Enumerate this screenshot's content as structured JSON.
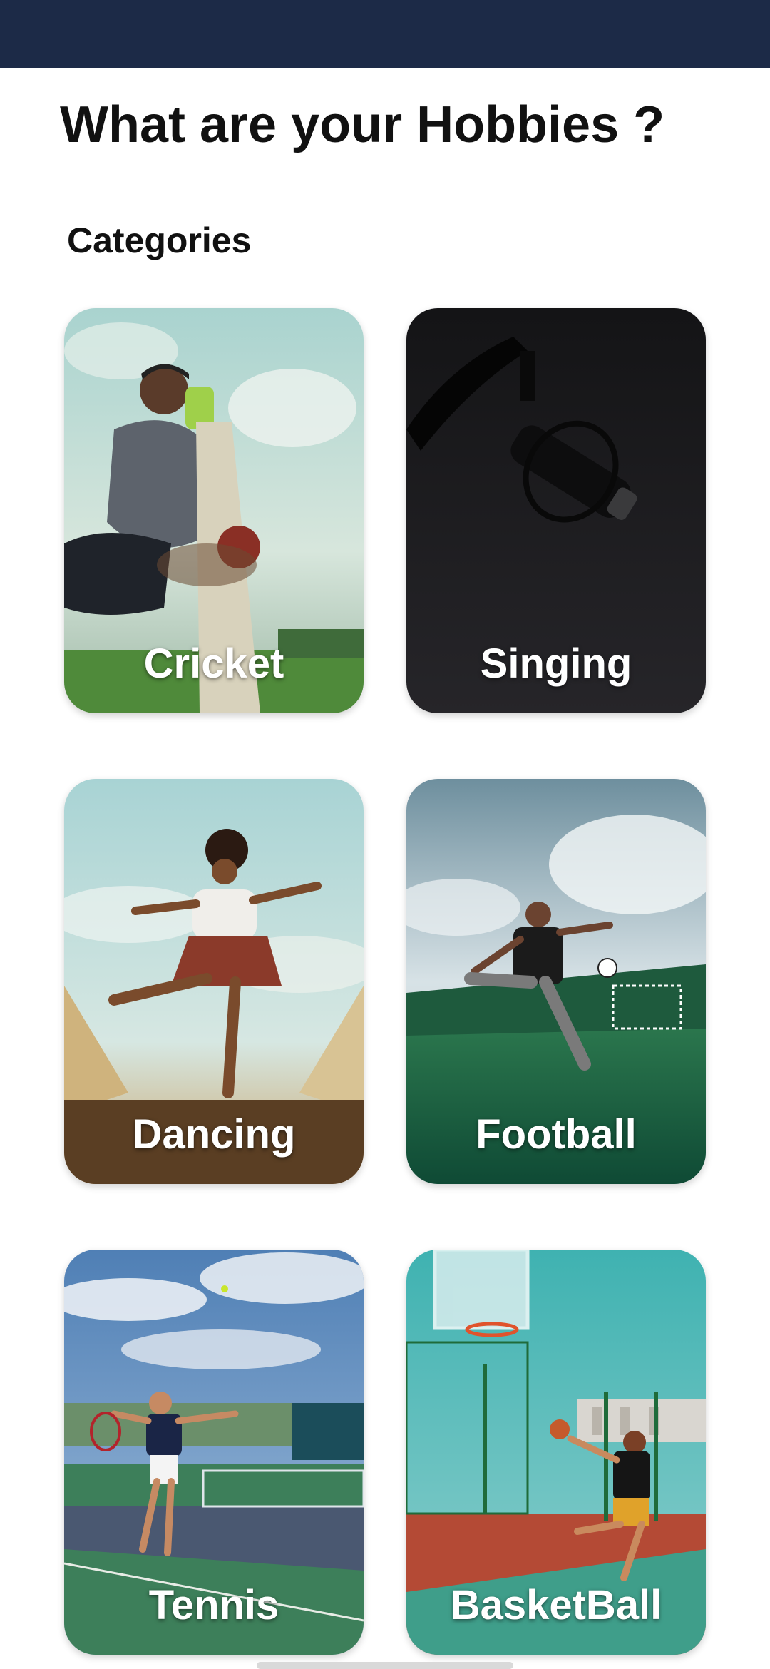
{
  "header": {
    "title": "What are your Hobbies ?",
    "section_label": "Categories"
  },
  "categories": [
    {
      "label": "Cricket",
      "icon": "cricket-photo"
    },
    {
      "label": "Singing",
      "icon": "microphone-photo"
    },
    {
      "label": "Dancing",
      "icon": "dancer-photo"
    },
    {
      "label": "Football",
      "icon": "football-player-photo"
    },
    {
      "label": "Tennis",
      "icon": "tennis-player-photo"
    },
    {
      "label": "BasketBall",
      "icon": "basketball-player-photo"
    }
  ],
  "colors": {
    "status_bar": "#1c2a47",
    "title_text": "#111111",
    "card_label": "#ffffff"
  }
}
